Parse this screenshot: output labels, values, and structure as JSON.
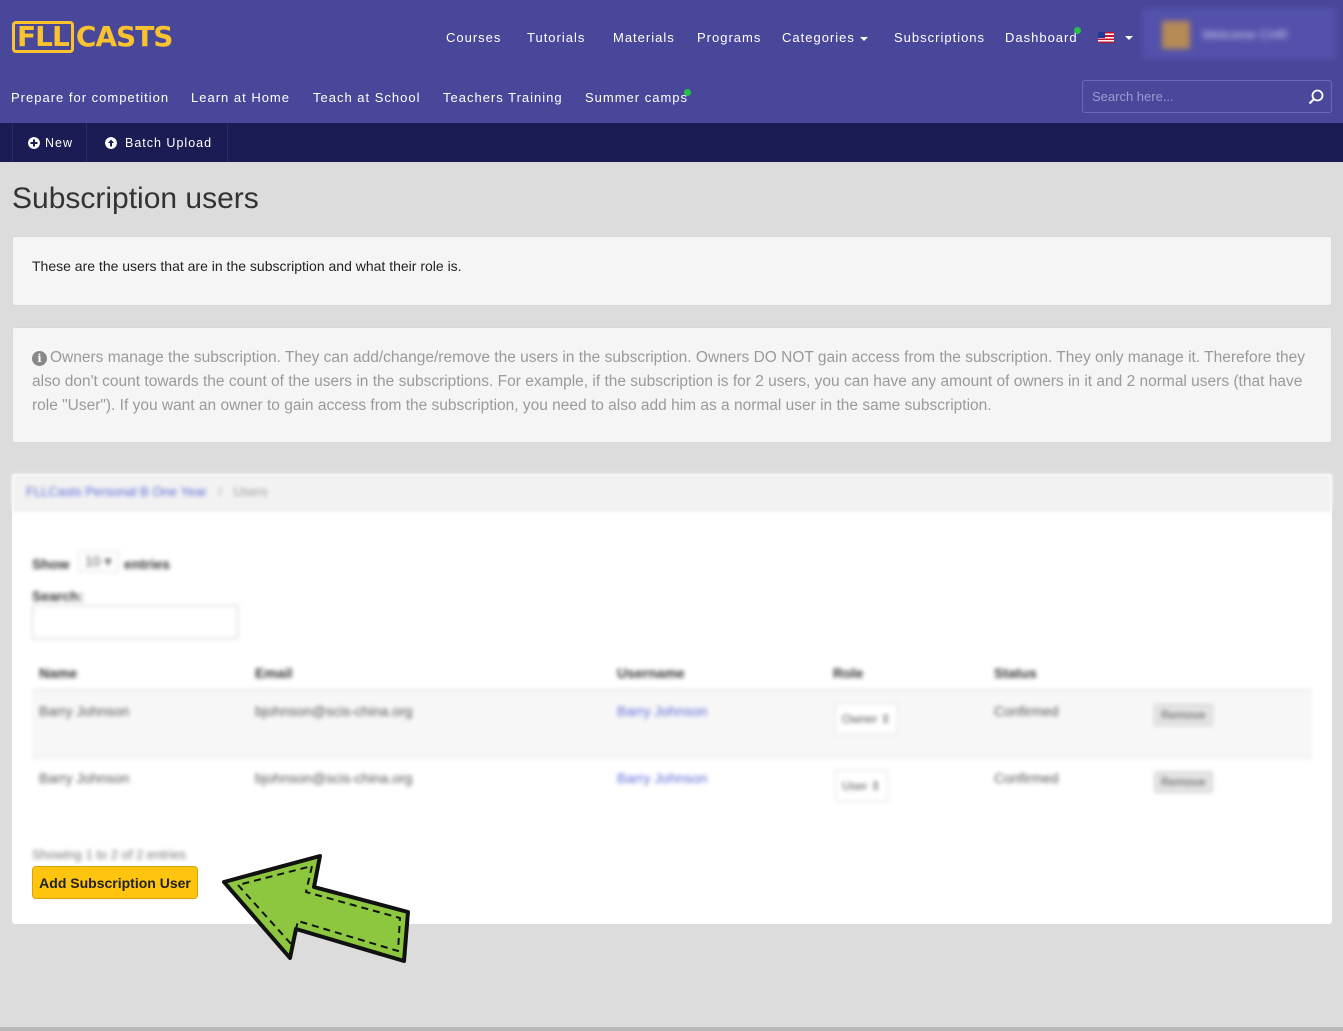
{
  "brand": {
    "logo_boxed": "FLL",
    "logo_rest": "CASTS",
    "accent": "#f9c22e",
    "nav_bg": "#494799",
    "actionbar_bg": "#1c1c54"
  },
  "topnav": {
    "items": [
      "Courses",
      "Tutorials",
      "Materials",
      "Programs",
      "Categories",
      "Subscriptions",
      "Dashboard"
    ],
    "user_name": "Welcome CHR"
  },
  "subnav": {
    "items": [
      "Prepare for competition",
      "Learn at Home",
      "Teach at School",
      "Teachers Training",
      "Summer camps"
    ],
    "search_placeholder": "Search here..."
  },
  "actions": {
    "new_label": "New",
    "batch_label": "Batch Upload"
  },
  "page": {
    "title": "Subscription users",
    "intro": "These are the users that are in the subscription and what their role is.",
    "info": "Owners manage the subscription. They can add/change/remove the users in the subscription. Owners DO NOT gain access from the subscription. They only manage it. Therefore they also don't count towards the count of the users in the subscriptions. For example, if the subscription is for 2 users, you can have any amount of owners in it and 2 normal users (that have role \"User\"). If you want an owner to gain access from the subscription, you need to also add him as a normal user in the same subscription."
  },
  "card": {
    "breadcrumb": [
      "FLLCasts Personal B One Year",
      "Users"
    ],
    "show_label": "Show",
    "entries_value": "10",
    "entries_label": "entries",
    "search_label": "Search:",
    "columns": [
      "Name",
      "Email",
      "Username",
      "Role",
      "Status"
    ],
    "rows": [
      {
        "name": "Barry Johnson",
        "email": "bjohnson@scis-china.org",
        "username": "Barry Johnson",
        "role": "Owner",
        "status": "Confirmed",
        "action": "Remove"
      },
      {
        "name": "Barry Johnson",
        "email": "bjohnson@scis-china.org",
        "username": "Barry Johnson",
        "role": "User",
        "status": "Confirmed",
        "action": "Remove"
      }
    ],
    "showing": "Showing 1 to 2 of 2 entries",
    "add_button": "Add Subscription User"
  },
  "annotation": {
    "arrow_color": "#8dc63f",
    "arrow_icon": "pointing-arrow-icon"
  }
}
